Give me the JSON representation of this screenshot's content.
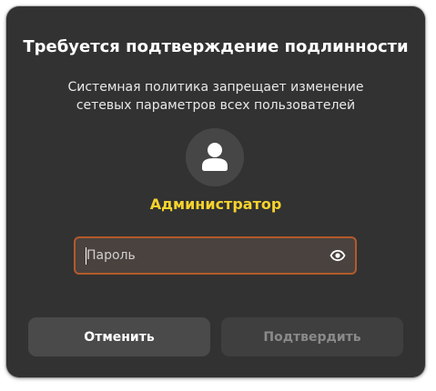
{
  "dialog": {
    "title": "Требуется подтверждение подлинности",
    "description": "Системная политика запрещает изменение сетевых параметров всех пользователей",
    "avatar_icon": "user-avatar-icon",
    "username": "Администратор",
    "password": {
      "value": "",
      "placeholder": "Пароль",
      "reveal_icon": "eye-icon"
    },
    "buttons": {
      "cancel_label": "Отменить",
      "confirm_label": "Подтвердить"
    },
    "colors": {
      "background": "#323232",
      "username": "#f6d32d",
      "field_border_focus": "#b35a2a"
    }
  }
}
